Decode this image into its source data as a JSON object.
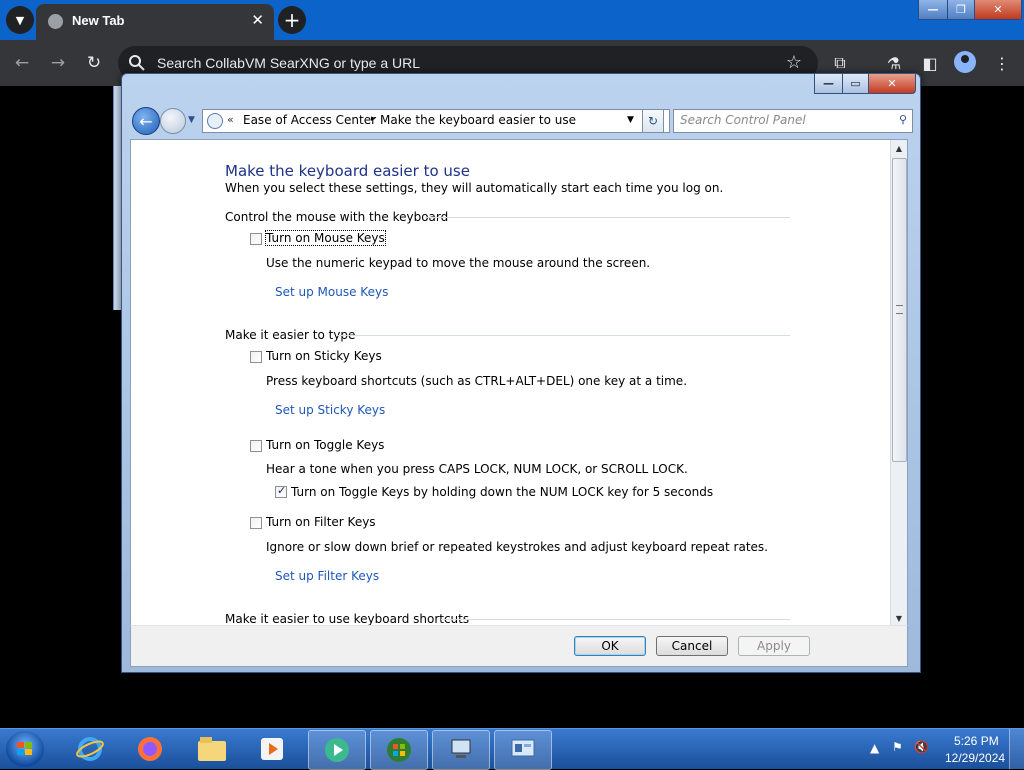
{
  "browser": {
    "tab_title": "New Tab",
    "tab_close": "✕",
    "new_tab": "+",
    "omnibox_text": "Search CollabVM SearXNG or type a URL",
    "win_min": "—",
    "win_max": "❐",
    "win_close": "✕"
  },
  "window": {
    "min": "—",
    "max": "▭",
    "close": "✕",
    "address": {
      "chevron": "«",
      "crumb1": "Ease of Access Center",
      "separator": "▸",
      "crumb2": "Make the keyboard easier to use"
    },
    "search_placeholder": "Search Control Panel"
  },
  "content": {
    "title": "Make the keyboard easier to use",
    "subtitle": "When you select these settings, they will automatically start each time you log on.",
    "sections": {
      "mouse": "Control the mouse with the keyboard",
      "type": "Make it easier to type",
      "shortcuts": "Make it easier to use keyboard shortcuts"
    },
    "mouse_keys": {
      "label": "Turn on Mouse Keys",
      "checked": false,
      "desc": "Use the numeric keypad to move the mouse around the screen.",
      "link": "Set up Mouse Keys"
    },
    "sticky_keys": {
      "label": "Turn on Sticky Keys",
      "checked": false,
      "desc": "Press keyboard shortcuts (such as CTRL+ALT+DEL) one key at a time.",
      "link": "Set up Sticky Keys"
    },
    "toggle_keys": {
      "label": "Turn on Toggle Keys",
      "checked": false,
      "desc": "Hear a tone when you press CAPS LOCK, NUM LOCK, or SCROLL LOCK.",
      "sub_label": "Turn on Toggle Keys by holding down the NUM LOCK key for 5 seconds",
      "sub_checked": true
    },
    "filter_keys": {
      "label": "Turn on Filter Keys",
      "checked": false,
      "desc": "Ignore or slow down brief or repeated keystrokes and adjust keyboard repeat rates.",
      "link": "Set up Filter Keys"
    }
  },
  "buttons": {
    "ok": "OK",
    "cancel": "Cancel",
    "apply": "Apply"
  },
  "taskbar": {
    "items": [
      "internet-explorer",
      "firefox",
      "windows-explorer",
      "media-player",
      "collabvm-app",
      "windows-media-center",
      "network-connections",
      "control-panel"
    ],
    "time": "5:26 PM",
    "date": "12/29/2024"
  },
  "colors": {
    "chrome_tabbar": "#0c63c9",
    "chrome_toolbar": "#35363a",
    "link": "#1e57b8",
    "title": "#1e3287",
    "taskbar": "#1b4f9a"
  }
}
